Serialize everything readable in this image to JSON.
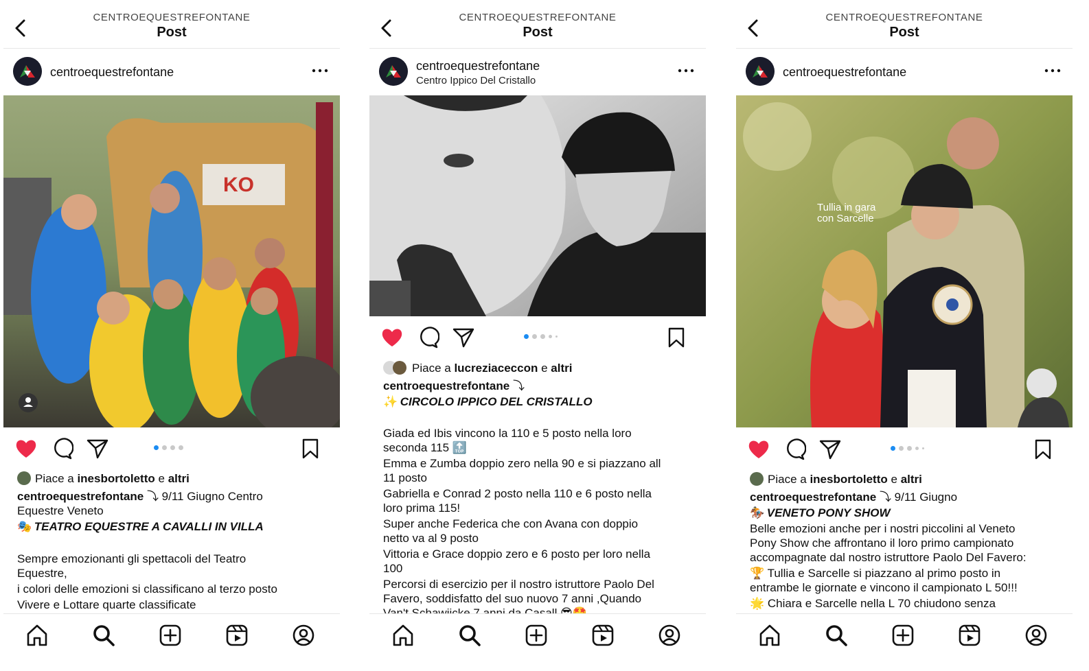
{
  "header": {
    "account": "CENTROEQUESTREFONTANE",
    "title": "Post"
  },
  "posts": [
    {
      "account": "centroequestrefontane",
      "location": "",
      "image_alt": "Children in colored leotards raising arms on stage outdoors",
      "liked": true,
      "carousel": {
        "count": 4,
        "active": 0
      },
      "likes": {
        "prefix": "Piace a",
        "user": "inesbortoletto",
        "and": "e",
        "others": "altri"
      },
      "caption": {
        "author": "centroequestrefontane",
        "line1": "⤵ 9/11 Giugno Centro",
        "line2": "Equestre Veneto",
        "emoji": "🎭",
        "headline": "TEATRO EQUESTRE A CAVALLI IN VILLA",
        "body": [
          "Sempre emozionanti gli spettacoli del Teatro",
          "Equestre,",
          "i colori delle emozioni si classificano al terzo posto",
          "Vivere e Lottare quarte classificate"
        ]
      }
    },
    {
      "account": "centroequestrefontane",
      "location": "Centro Ippico Del Cristallo",
      "image_alt": "Black and white photo of rider hugging a white horse",
      "liked": true,
      "carousel": {
        "count": 5,
        "active": 0
      },
      "likes": {
        "prefix": "Piace a",
        "user": "lucreziaceccon",
        "and": "e",
        "others": "altri"
      },
      "caption": {
        "author": "centroequestrefontane",
        "line1": "⤵",
        "emoji": "✨",
        "headline": "CIRCOLO IPPICO DEL CRISTALLO",
        "body": [
          "Giada ed Ibis vincono la 110 e 5 posto nella loro",
          "seconda 115 🔝",
          "Emma e Zumba doppio zero nella 90 e si piazzano all",
          "11 posto",
          "Gabriella e Conrad 2 posto nella 110 e 6 posto nella",
          "loro prima 115!",
          "Super anche Federica che con Avana con doppio",
          "netto va al 9 posto",
          "Vittoria e Grace doppio zero e 6 posto per loro nella",
          "100",
          "Percorsi di esercizio per il nostro istruttore Paolo Del",
          "Favero, soddisfatto del suo nuovo 7 anni ,Quando",
          "Van't Schawiicke 7 anni da Casall 😎🤩"
        ]
      }
    },
    {
      "account": "centroequestrefontane",
      "location": "",
      "image_alt": "Young rider with trophy, man and woman at show, caption Tullia in gara con Sarcelle",
      "image_text": [
        "Tullia in gara",
        "con Sarcelle"
      ],
      "liked": true,
      "carousel": {
        "count": 5,
        "active": 0
      },
      "likes": {
        "prefix": "Piace a",
        "user": "inesbortoletto",
        "and": "e",
        "others": "altri"
      },
      "caption": {
        "author": "centroequestrefontane",
        "line1": "⤵ 9/11 Giugno",
        "emoji": "🏇",
        "headline": "VENETO PONY SHOW",
        "body": [
          "Belle emozioni anche per i nostri piccolini al Veneto",
          "Pony Show che affrontano il loro primo campionato",
          "accompagnate dal nostro istruttore Paolo Del Favero:",
          "🏆 Tullia e Sarcelle si piazzano al primo posto in",
          "entrambe le giornate  e vincono il campionato L 50!!!",
          "🌟 Chiara e Sarcelle nella  L 70 chiudono senza"
        ]
      }
    }
  ],
  "tabbar": [
    "home-icon",
    "search-icon",
    "create-icon",
    "reels-icon",
    "profile-icon"
  ],
  "colors": {
    "like": "#ed2a4a",
    "carousel_active": "#1b8cf2",
    "border": "#e6e6e6"
  }
}
